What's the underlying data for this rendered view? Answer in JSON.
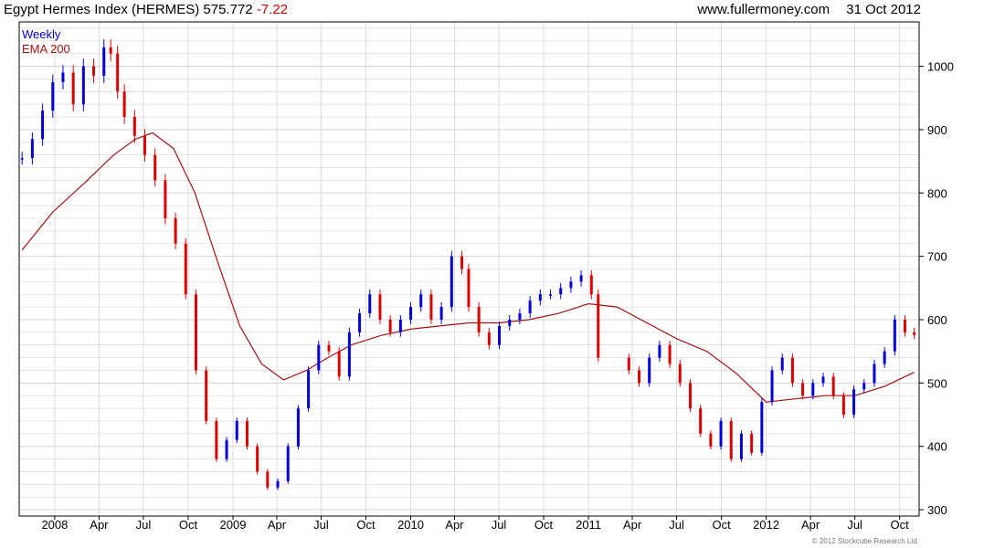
{
  "header": {
    "title": "Egypt Hermes Index (HERMES)",
    "last_value": "575.772",
    "change": "-7.22",
    "source": "www.fullermoney.com",
    "date": "31 Oct 2012"
  },
  "legend": {
    "series_label": "Weekly",
    "ema_label": "EMA 200"
  },
  "copyright": "© 2012 Stockcube Research Ltd",
  "colors": {
    "up": "#0000dd",
    "down": "#dd0000",
    "ema": "#a51010",
    "grid": "#d4d4d4",
    "axis": "#000000"
  },
  "chart_data": {
    "type": "line",
    "series": [
      {
        "name": "Weekly",
        "style": "ohlc-bars",
        "x": [
          "2007-10-26",
          "2007-11-16",
          "2007-12-07",
          "2007-12-28",
          "2008-01-18",
          "2008-02-08",
          "2008-02-29",
          "2008-03-21",
          "2008-04-11",
          "2008-04-25",
          "2008-05-09",
          "2008-05-23",
          "2008-06-13",
          "2008-07-04",
          "2008-07-25",
          "2008-08-15",
          "2008-09-05",
          "2008-09-26",
          "2008-10-17",
          "2008-11-07",
          "2008-11-28",
          "2008-12-19",
          "2009-01-09",
          "2009-01-30",
          "2009-02-20",
          "2009-03-13",
          "2009-04-03",
          "2009-04-24",
          "2009-05-15",
          "2009-06-05",
          "2009-06-26",
          "2009-07-17",
          "2009-08-07",
          "2009-08-28",
          "2009-09-18",
          "2009-10-09",
          "2009-10-30",
          "2009-11-20",
          "2009-12-11",
          "2010-01-01",
          "2010-01-22",
          "2010-02-12",
          "2010-03-05",
          "2010-03-26",
          "2010-04-16",
          "2010-04-30",
          "2010-05-21",
          "2010-06-11",
          "2010-07-02",
          "2010-07-23",
          "2010-08-13",
          "2010-09-03",
          "2010-09-24",
          "2010-10-15",
          "2010-11-05",
          "2010-11-26",
          "2010-12-17",
          "2011-01-07",
          "2011-01-21",
          "2011-03-25",
          "2011-04-15",
          "2011-05-06",
          "2011-05-27",
          "2011-06-17",
          "2011-07-08",
          "2011-07-29",
          "2011-08-19",
          "2011-09-09",
          "2011-09-30",
          "2011-10-21",
          "2011-11-11",
          "2011-12-02",
          "2011-12-23",
          "2012-01-13",
          "2012-02-03",
          "2012-02-24",
          "2012-03-16",
          "2012-04-06",
          "2012-04-27",
          "2012-05-18",
          "2012-06-08",
          "2012-06-29",
          "2012-07-20",
          "2012-08-10",
          "2012-08-31",
          "2012-09-21",
          "2012-10-12",
          "2012-10-31"
        ],
        "values": [
          855,
          885,
          930,
          975,
          990,
          940,
          1000,
          985,
          1030,
          1020,
          960,
          920,
          890,
          860,
          820,
          760,
          720,
          640,
          520,
          440,
          380,
          410,
          440,
          400,
          360,
          335,
          345,
          400,
          460,
          520,
          560,
          550,
          510,
          580,
          610,
          640,
          600,
          580,
          600,
          620,
          640,
          600,
          620,
          700,
          680,
          620,
          580,
          560,
          590,
          600,
          610,
          630,
          640,
          640,
          650,
          660,
          670,
          640,
          540,
          520,
          500,
          540,
          560,
          530,
          500,
          460,
          420,
          400,
          440,
          380,
          420,
          390,
          470,
          520,
          540,
          500,
          480,
          500,
          510,
          480,
          450,
          490,
          500,
          530,
          550,
          600,
          580,
          576
        ]
      },
      {
        "name": "EMA 200",
        "style": "line",
        "x": [
          "2007-10-26",
          "2007-12-28",
          "2008-03-01",
          "2008-05-01",
          "2008-06-15",
          "2008-07-20",
          "2008-09-01",
          "2008-10-15",
          "2008-12-01",
          "2009-01-15",
          "2009-03-01",
          "2009-04-15",
          "2009-06-01",
          "2009-07-15",
          "2009-09-01",
          "2009-11-01",
          "2010-01-01",
          "2010-03-01",
          "2010-05-01",
          "2010-07-01",
          "2010-09-01",
          "2010-11-01",
          "2011-01-01",
          "2011-03-01",
          "2011-05-01",
          "2011-07-01",
          "2011-09-01",
          "2011-11-01",
          "2012-01-01",
          "2012-03-01",
          "2012-05-01",
          "2012-07-01",
          "2012-09-01",
          "2012-10-31"
        ],
        "values": [
          710,
          770,
          815,
          860,
          885,
          895,
          870,
          800,
          690,
          590,
          530,
          505,
          520,
          540,
          560,
          575,
          585,
          590,
          595,
          595,
          600,
          610,
          625,
          620,
          595,
          570,
          550,
          515,
          470,
          475,
          480,
          480,
          495,
          517
        ]
      }
    ],
    "x_ticks": [
      "2008",
      "Apr",
      "Jul",
      "Oct",
      "2009",
      "Apr",
      "Jul",
      "Oct",
      "2010",
      "Apr",
      "Jul",
      "Oct",
      "2011",
      "Apr",
      "Jul",
      "Oct",
      "2012",
      "Apr",
      "Jul",
      "Oct"
    ],
    "x_tick_dates": [
      "2008-01-01",
      "2008-04-01",
      "2008-07-01",
      "2008-10-01",
      "2009-01-01",
      "2009-04-01",
      "2009-07-01",
      "2009-10-01",
      "2010-01-01",
      "2010-04-01",
      "2010-07-01",
      "2010-10-01",
      "2011-01-01",
      "2011-04-01",
      "2011-07-01",
      "2011-10-01",
      "2012-01-01",
      "2012-04-01",
      "2012-07-01",
      "2012-10-01"
    ],
    "y_ticks": [
      300,
      400,
      500,
      600,
      700,
      800,
      900,
      1000
    ],
    "xlim": [
      "2007-10-20",
      "2012-11-10"
    ],
    "ylim": [
      290,
      1070
    ],
    "y_axis_side": "right",
    "grid": true,
    "legend_position": "top-left"
  }
}
